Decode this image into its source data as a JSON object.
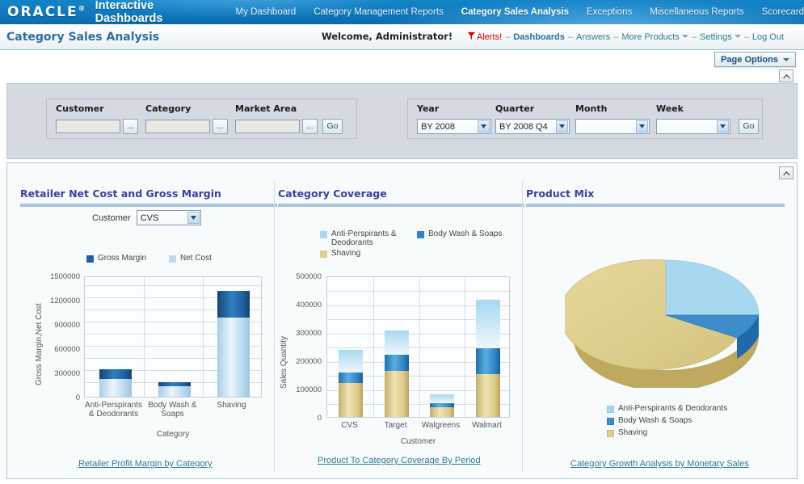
{
  "brand": {
    "logo": "ORACLE",
    "logo_mark": "®",
    "app_title": "Interactive Dashboards"
  },
  "nav": {
    "items": [
      {
        "label": "My Dashboard",
        "active": false
      },
      {
        "label": "Category Management Reports",
        "active": false
      },
      {
        "label": "Category Sales Analysis",
        "active": true
      },
      {
        "label": "Exceptions",
        "active": false
      },
      {
        "label": "Miscellaneous Reports",
        "active": false
      },
      {
        "label": "Scorecard",
        "active": false
      }
    ]
  },
  "header": {
    "page_title": "Category Sales Analysis",
    "welcome": "Welcome, Administrator!",
    "alerts_label": "Alerts!",
    "links": [
      {
        "label": "Dashboards",
        "strong": true,
        "caret": false
      },
      {
        "label": "Answers",
        "strong": false,
        "caret": false
      },
      {
        "label": "More Products",
        "strong": false,
        "caret": true
      },
      {
        "label": "Settings",
        "strong": false,
        "caret": true
      },
      {
        "label": "Log Out",
        "strong": false,
        "caret": false
      }
    ],
    "separator": "–",
    "page_options_label": "Page Options"
  },
  "prompts": {
    "left": {
      "fields": [
        {
          "label": "Customer",
          "value": "",
          "choose_label": "..."
        },
        {
          "label": "Category",
          "value": "",
          "choose_label": "..."
        },
        {
          "label": "Market Area",
          "value": "",
          "choose_label": "..."
        }
      ],
      "go_label": "Go"
    },
    "right": {
      "fields": [
        {
          "label": "Year",
          "value": "BY 2008"
        },
        {
          "label": "Quarter",
          "value": "BY 2008 Q4"
        },
        {
          "label": "Month",
          "value": ""
        },
        {
          "label": "Week",
          "value": ""
        }
      ],
      "go_label": "Go"
    }
  },
  "sections": [
    {
      "title": "Retailer Net Cost and Gross Margin",
      "link": "Retailer Profit Margin by Category"
    },
    {
      "title": "Category Coverage",
      "link": "Product To Category Coverage By Period"
    },
    {
      "title": "Product Mix",
      "link": "Category Growth Analysis by Monetary Sales"
    }
  ],
  "report1_prompt": {
    "label": "Customer",
    "value": "CVS"
  },
  "colors": {
    "gross_margin": "#1f5f9e",
    "net_cost": "#bcdcf0",
    "anti_persp": "#a8d8f0",
    "body_wash": "#2f84c8",
    "shaving": "#e0cf8c",
    "accent": "#3a3f9e",
    "link": "#2e7c96"
  },
  "chart_data": [
    {
      "type": "bar",
      "stacked": true,
      "title": "Retailer Net Cost and Gross Margin",
      "xlabel": "Category",
      "ylabel": "Gross Margin,Net Cost",
      "ylim": [
        0,
        1500000
      ],
      "yticks": [
        0,
        300000,
        600000,
        900000,
        1200000,
        1500000
      ],
      "gridstep": 100000,
      "grid": true,
      "legend_position": "top",
      "categories": [
        "Anti-Perspirants & Deodorants",
        "Body Wash & Soaps",
        "Shaving"
      ],
      "series": [
        {
          "name": "Net Cost",
          "values": [
            225000,
            130000,
            975000
          ]
        },
        {
          "name": "Gross Margin",
          "values": [
            115000,
            48000,
            335000
          ]
        }
      ],
      "totals": [
        340000,
        178000,
        1310000
      ]
    },
    {
      "type": "bar",
      "stacked": true,
      "title": "Category Coverage",
      "xlabel": "Customer",
      "ylabel": "Sales Quantity",
      "ylim": [
        0,
        500000
      ],
      "yticks": [
        0,
        100000,
        200000,
        300000,
        400000,
        500000
      ],
      "gridstep": 50000,
      "grid": true,
      "legend_position": "top",
      "categories": [
        "CVS",
        "Target",
        "Walgreens",
        "Walmart"
      ],
      "series": [
        {
          "name": "Shaving",
          "values": [
            120000,
            162000,
            35000,
            152000
          ]
        },
        {
          "name": "Body Wash & Soaps",
          "values": [
            37000,
            58000,
            13000,
            90000
          ]
        },
        {
          "name": "Anti-Perspirants & Deodorants",
          "values": [
            80000,
            85000,
            32000,
            171000
          ]
        }
      ],
      "totals": [
        237000,
        305000,
        80000,
        413000
      ]
    },
    {
      "type": "pie",
      "title": "Product Mix",
      "legend_position": "bottom",
      "labels": [
        "Anti-Perspirants & Deodorants",
        "Body Wash & Soaps",
        "Shaving"
      ],
      "values": [
        22,
        13,
        65
      ]
    }
  ]
}
